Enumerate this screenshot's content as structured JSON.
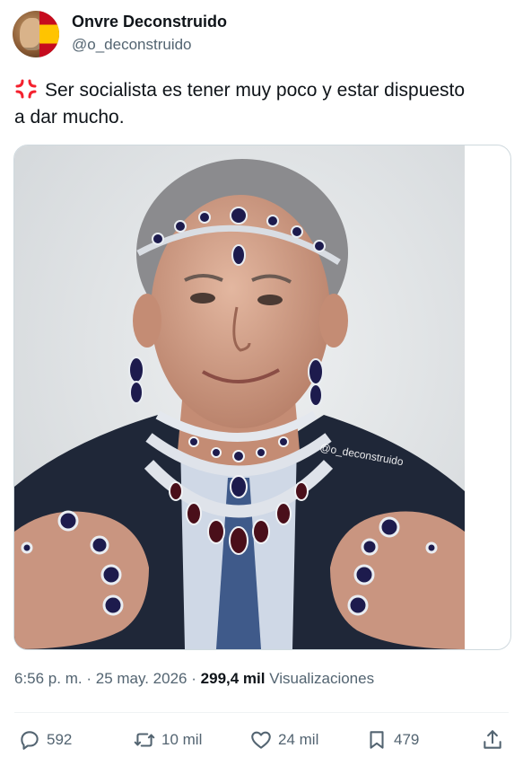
{
  "author": {
    "display_name": "Onvre Deconstruido",
    "handle": "@o_deconstruido"
  },
  "tweet": {
    "emoji_icon": "anger-symbol-icon",
    "text_line1": "Ser socialista es tener muy poco y estar dispuesto",
    "text_line2": "a dar mucho."
  },
  "media": {
    "watermark": "@o_deconstruido"
  },
  "meta": {
    "time": "6:56 p. m.",
    "sep1": "·",
    "date": "25 may. 2026",
    "sep2": "·",
    "views_count": "299,4 mil",
    "views_label": "Visualizaciones"
  },
  "actions": {
    "replies": "592",
    "reposts": "10 mil",
    "likes": "24 mil",
    "bookmarks": "479"
  },
  "colors": {
    "text": "#0f1419",
    "secondary": "#536471",
    "border": "#cfd9de",
    "anger": "#f4212e"
  }
}
